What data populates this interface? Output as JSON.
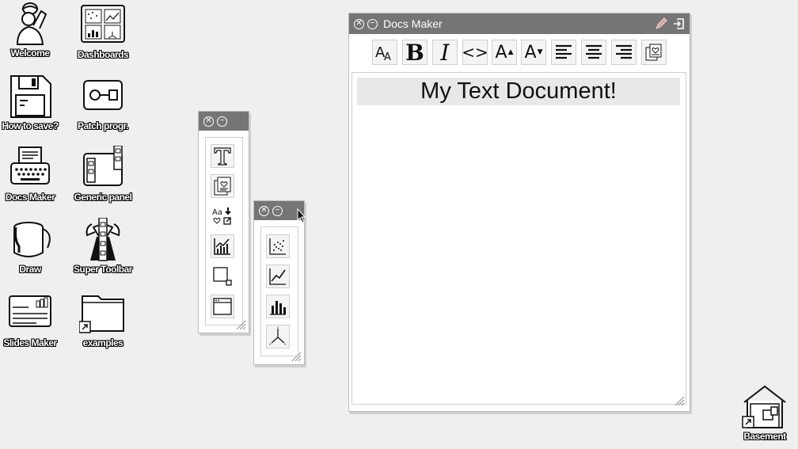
{
  "desktop": {
    "icons": [
      {
        "label": "Welcome",
        "icon": "person-reading-icon"
      },
      {
        "label": "Dashboards",
        "icon": "dashboard-icon"
      },
      {
        "label": "How to save?",
        "icon": "floppy-disk-icon"
      },
      {
        "label": "Patch progr.",
        "icon": "patch-program-icon"
      },
      {
        "label": "Docs Maker",
        "icon": "typewriter-icon"
      },
      {
        "label": "Generic panel",
        "icon": "generic-panel-icon"
      },
      {
        "label": "Draw",
        "icon": "paint-bucket-icon"
      },
      {
        "label": "Super Toolbar",
        "icon": "super-toolbar-icon"
      },
      {
        "label": "Slides Maker",
        "icon": "slides-icon"
      },
      {
        "label": "examples",
        "icon": "folder-shortcut-icon"
      },
      {
        "label": "Basement",
        "icon": "basement-house-icon"
      }
    ]
  },
  "docs_window": {
    "title": "Docs Maker",
    "heading": "My Text Document!",
    "toolbar": {
      "font": "A",
      "bold": "B",
      "italic": "I",
      "code": "<>",
      "increase": "A",
      "decrease": "A"
    }
  },
  "colors": {
    "desktop": "#efefef",
    "titlebar": "#757575",
    "button": "#f4f4f4"
  }
}
